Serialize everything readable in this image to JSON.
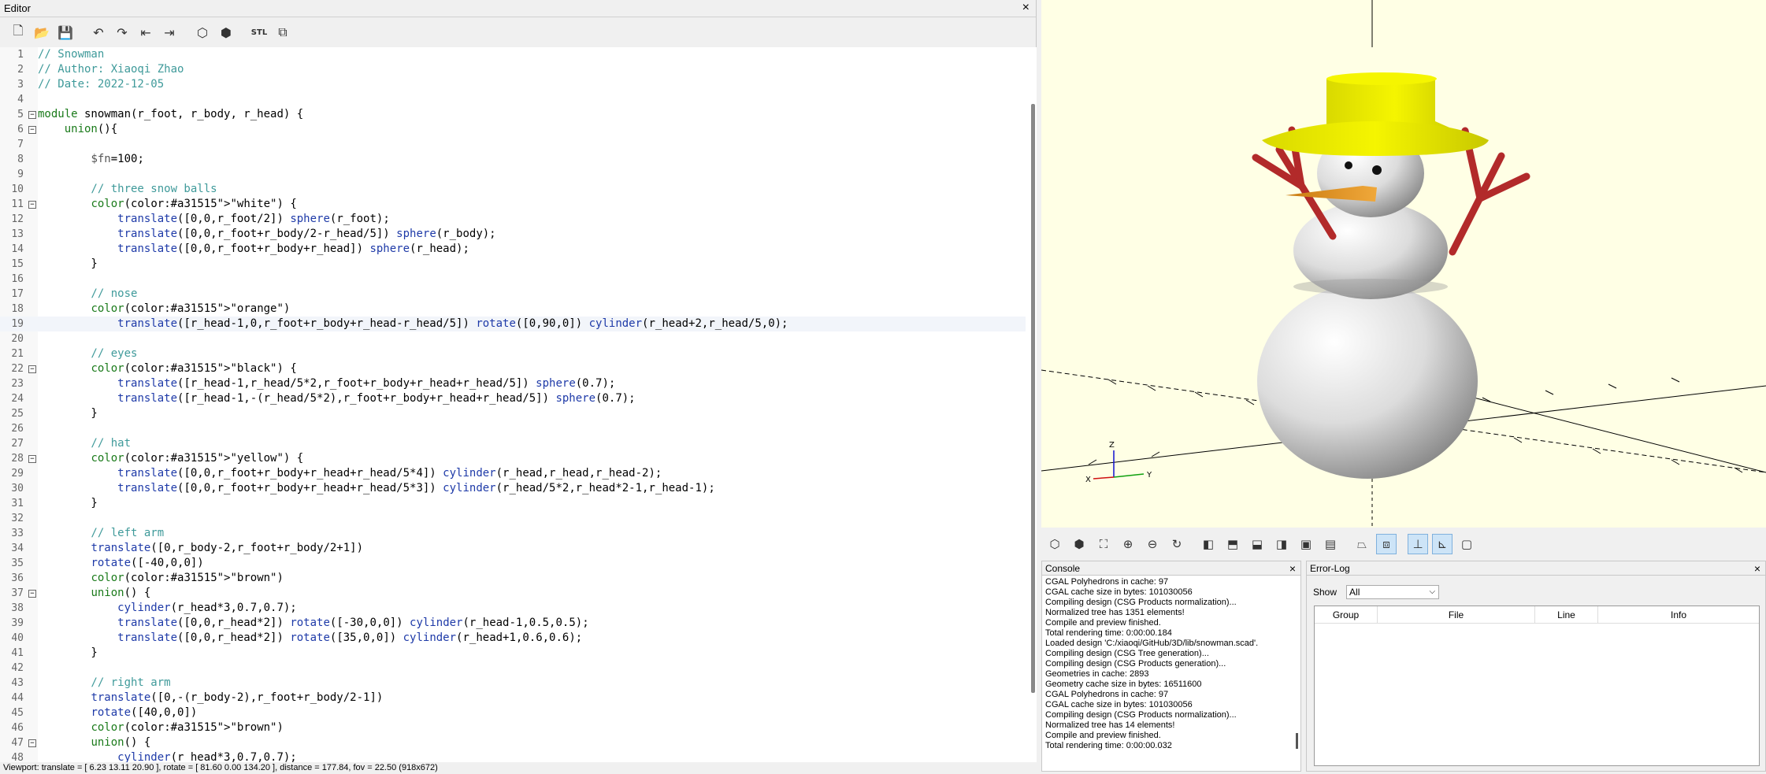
{
  "editor": {
    "title": "Editor",
    "close": "×",
    "toolbar": [
      {
        "name": "new-file-icon",
        "glyph": "🗋"
      },
      {
        "name": "open-file-icon",
        "glyph": "📂"
      },
      {
        "name": "save-icon",
        "glyph": "💾"
      },
      {
        "name": "undo-icon",
        "glyph": "↶"
      },
      {
        "name": "redo-icon",
        "glyph": "↷"
      },
      {
        "name": "unindent-icon",
        "glyph": "⇤"
      },
      {
        "name": "indent-icon",
        "glyph": "⇥"
      },
      {
        "name": "preview-icon",
        "glyph": "⬡"
      },
      {
        "name": "render-icon",
        "glyph": "⬢"
      },
      {
        "name": "export-stl-icon",
        "glyph": "STL"
      },
      {
        "name": "send-to-print-icon",
        "glyph": "⧉"
      }
    ],
    "lines": [
      {
        "n": "1",
        "t": "// Snowman",
        "fold": false
      },
      {
        "n": "2",
        "t": "// Author: Xiaoqi Zhao",
        "fold": false
      },
      {
        "n": "3",
        "t": "// Date: 2022-12-05",
        "fold": false
      },
      {
        "n": "4",
        "t": "",
        "fold": false
      },
      {
        "n": "5",
        "t": "module snowman(r_foot, r_body, r_head) {",
        "fold": true
      },
      {
        "n": "6",
        "t": "    union(){",
        "fold": true
      },
      {
        "n": "7",
        "t": "",
        "fold": false
      },
      {
        "n": "8",
        "t": "        $fn=100;",
        "fold": false
      },
      {
        "n": "9",
        "t": "",
        "fold": false
      },
      {
        "n": "10",
        "t": "        // three snow balls",
        "fold": false
      },
      {
        "n": "11",
        "t": "        color(\"white\") {",
        "fold": true
      },
      {
        "n": "12",
        "t": "            translate([0,0,r_foot/2]) sphere(r_foot);",
        "fold": false
      },
      {
        "n": "13",
        "t": "            translate([0,0,r_foot+r_body/2-r_head/5]) sphere(r_body);",
        "fold": false
      },
      {
        "n": "14",
        "t": "            translate([0,0,r_foot+r_body+r_head]) sphere(r_head);",
        "fold": false
      },
      {
        "n": "15",
        "t": "        }",
        "fold": false
      },
      {
        "n": "16",
        "t": "",
        "fold": false
      },
      {
        "n": "17",
        "t": "        // nose",
        "fold": false
      },
      {
        "n": "18",
        "t": "        color(\"orange\")",
        "fold": false
      },
      {
        "n": "19",
        "t": "            translate([r_head-1,0,r_foot+r_body+r_head-r_head/5]) rotate([0,90,0]) cylinder(r_head+2,r_head/5,0);",
        "fold": false
      },
      {
        "n": "20",
        "t": "",
        "fold": false
      },
      {
        "n": "21",
        "t": "        // eyes",
        "fold": false
      },
      {
        "n": "22",
        "t": "        color(\"black\") {",
        "fold": true
      },
      {
        "n": "23",
        "t": "            translate([r_head-1,r_head/5*2,r_foot+r_body+r_head+r_head/5]) sphere(0.7);",
        "fold": false
      },
      {
        "n": "24",
        "t": "            translate([r_head-1,-(r_head/5*2),r_foot+r_body+r_head+r_head/5]) sphere(0.7);",
        "fold": false
      },
      {
        "n": "25",
        "t": "        }",
        "fold": false
      },
      {
        "n": "26",
        "t": "",
        "fold": false
      },
      {
        "n": "27",
        "t": "        // hat",
        "fold": false
      },
      {
        "n": "28",
        "t": "        color(\"yellow\") {",
        "fold": true
      },
      {
        "n": "29",
        "t": "            translate([0,0,r_foot+r_body+r_head+r_head/5*4]) cylinder(r_head,r_head,r_head-2);",
        "fold": false
      },
      {
        "n": "30",
        "t": "            translate([0,0,r_foot+r_body+r_head+r_head/5*3]) cylinder(r_head/5*2,r_head*2-1,r_head-1);",
        "fold": false
      },
      {
        "n": "31",
        "t": "        }",
        "fold": false
      },
      {
        "n": "32",
        "t": "",
        "fold": false
      },
      {
        "n": "33",
        "t": "        // left arm",
        "fold": false
      },
      {
        "n": "34",
        "t": "        translate([0,r_body-2,r_foot+r_body/2+1])",
        "fold": false
      },
      {
        "n": "35",
        "t": "        rotate([-40,0,0])",
        "fold": false
      },
      {
        "n": "36",
        "t": "        color(\"brown\")",
        "fold": false
      },
      {
        "n": "37",
        "t": "        union() {",
        "fold": true
      },
      {
        "n": "38",
        "t": "            cylinder(r_head*3,0.7,0.7);",
        "fold": false
      },
      {
        "n": "39",
        "t": "            translate([0,0,r_head*2]) rotate([-30,0,0]) cylinder(r_head-1,0.5,0.5);",
        "fold": false
      },
      {
        "n": "40",
        "t": "            translate([0,0,r_head*2]) rotate([35,0,0]) cylinder(r_head+1,0.6,0.6);",
        "fold": false
      },
      {
        "n": "41",
        "t": "        }",
        "fold": false
      },
      {
        "n": "42",
        "t": "",
        "fold": false
      },
      {
        "n": "43",
        "t": "        // right arm",
        "fold": false
      },
      {
        "n": "44",
        "t": "        translate([0,-(r_body-2),r_foot+r_body/2-1])",
        "fold": false
      },
      {
        "n": "45",
        "t": "        rotate([40,0,0])",
        "fold": false
      },
      {
        "n": "46",
        "t": "        color(\"brown\")",
        "fold": false
      },
      {
        "n": "47",
        "t": "        union() {",
        "fold": true
      },
      {
        "n": "48",
        "t": "            cylinder(r_head*3,0.7,0.7);",
        "fold": false
      }
    ],
    "current_line": "19",
    "status": "Viewport: translate = [ 6.23 13.11 20.90 ], rotate = [ 81.60 0.00 134.20 ], distance = 177.84, fov = 22.50 (918x672)"
  },
  "viewer": {
    "axis_labels": {
      "x": "X",
      "y": "Y",
      "z": "Z"
    },
    "colors": {
      "background": "#ffffe5",
      "hat": "#e8e800",
      "snow": "#e6e6e6",
      "nose": "#e8971c",
      "arm": "#b22a2a",
      "eye": "#111111"
    },
    "toolbar": [
      {
        "name": "preview-icon",
        "glyph": "⬡",
        "on": false
      },
      {
        "name": "render-icon",
        "glyph": "⬢",
        "on": false
      },
      {
        "name": "view-all-icon",
        "glyph": "⛶",
        "on": false
      },
      {
        "name": "zoom-in-icon",
        "glyph": "⊕",
        "on": false
      },
      {
        "name": "zoom-out-icon",
        "glyph": "⊖",
        "on": false
      },
      {
        "name": "reset-view-icon",
        "glyph": "↻",
        "on": false
      },
      {
        "name": "sep",
        "glyph": "",
        "on": false
      },
      {
        "name": "view-right-icon",
        "glyph": "◧",
        "on": false
      },
      {
        "name": "view-top-icon",
        "glyph": "⬒",
        "on": false
      },
      {
        "name": "view-bottom-icon",
        "glyph": "⬓",
        "on": false
      },
      {
        "name": "view-left-icon",
        "glyph": "◨",
        "on": false
      },
      {
        "name": "view-front-icon",
        "glyph": "▣",
        "on": false
      },
      {
        "name": "view-back-icon",
        "glyph": "▤",
        "on": false
      },
      {
        "name": "sep",
        "glyph": "",
        "on": false
      },
      {
        "name": "perspective-icon",
        "glyph": "⏢",
        "on": false
      },
      {
        "name": "orthogonal-icon",
        "glyph": "⧈",
        "on": true
      },
      {
        "name": "sep",
        "glyph": "",
        "on": false
      },
      {
        "name": "show-axes-icon",
        "glyph": "⊥",
        "on": true
      },
      {
        "name": "show-scale-icon",
        "glyph": "⊾",
        "on": true
      },
      {
        "name": "show-edges-icon",
        "glyph": "▢",
        "on": false
      }
    ]
  },
  "console": {
    "title": "Console",
    "close": "×",
    "lines": [
      "CGAL Polyhedrons in cache: 97",
      "CGAL cache size in bytes: 101030056",
      "Compiling design (CSG Products normalization)...",
      "Normalized tree has 1351 elements!",
      "Compile and preview finished.",
      "Total rendering time: 0:00:00.184",
      "Loaded design 'C:/xiaoqi/GitHub/3D/lib/snowman.scad'.",
      "Compiling design (CSG Tree generation)...",
      "Compiling design (CSG Products generation)...",
      "Geometries in cache: 2893",
      "Geometry cache size in bytes: 16511600",
      "CGAL Polyhedrons in cache: 97",
      "CGAL cache size in bytes: 101030056",
      "Compiling design (CSG Products normalization)...",
      "Normalized tree has 14 elements!",
      "Compile and preview finished.",
      "Total rendering time: 0:00:00.032"
    ]
  },
  "errorlog": {
    "title": "Error-Log",
    "close": "×",
    "show_label": "Show",
    "show_value": "All",
    "columns": [
      "Group",
      "File",
      "Line",
      "Info"
    ]
  }
}
